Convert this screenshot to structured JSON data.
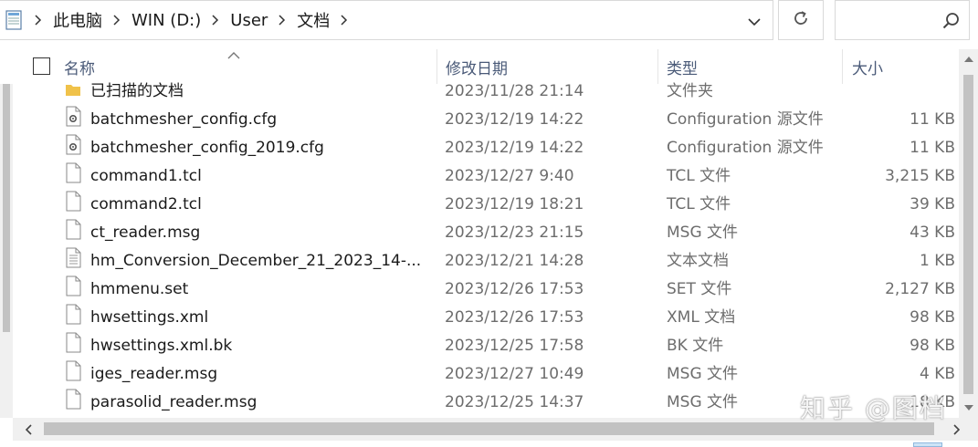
{
  "address_bar": {
    "crumbs": [
      "此电脑",
      "WIN (D:)",
      "User",
      "文档"
    ],
    "search_placeholder": ""
  },
  "columns": {
    "name": "名称",
    "date": "修改日期",
    "type": "类型",
    "size": "大小"
  },
  "files": [
    {
      "name": "已扫描的文档",
      "date": "2023/11/28 21:14",
      "type": "文件夹",
      "size": "",
      "icon": "folder-icon"
    },
    {
      "name": "batchmesher_config.cfg",
      "date": "2023/12/19 14:22",
      "type": "Configuration 源文件",
      "size": "11 KB",
      "icon": "config-file-icon"
    },
    {
      "name": "batchmesher_config_2019.cfg",
      "date": "2023/12/19 14:22",
      "type": "Configuration 源文件",
      "size": "11 KB",
      "icon": "config-file-icon"
    },
    {
      "name": "command1.tcl",
      "date": "2023/12/27 9:40",
      "type": "TCL 文件",
      "size": "3,215 KB",
      "icon": "file-icon"
    },
    {
      "name": "command2.tcl",
      "date": "2023/12/19 18:21",
      "type": "TCL 文件",
      "size": "39 KB",
      "icon": "file-icon"
    },
    {
      "name": "ct_reader.msg",
      "date": "2023/12/23 21:15",
      "type": "MSG 文件",
      "size": "43 KB",
      "icon": "file-icon"
    },
    {
      "name": "hm_Conversion_December_21_2023_14-...",
      "date": "2023/12/21 14:28",
      "type": "文本文档",
      "size": "1 KB",
      "icon": "text-file-icon"
    },
    {
      "name": "hmmenu.set",
      "date": "2023/12/26 17:53",
      "type": "SET 文件",
      "size": "2,127 KB",
      "icon": "file-icon"
    },
    {
      "name": "hwsettings.xml",
      "date": "2023/12/26 17:53",
      "type": "XML 文档",
      "size": "98 KB",
      "icon": "file-icon"
    },
    {
      "name": "hwsettings.xml.bk",
      "date": "2023/12/25 17:58",
      "type": "BK 文件",
      "size": "98 KB",
      "icon": "file-icon"
    },
    {
      "name": "iges_reader.msg",
      "date": "2023/12/27 10:49",
      "type": "MSG 文件",
      "size": "4 KB",
      "icon": "file-icon"
    },
    {
      "name": "parasolid_reader.msg",
      "date": "2023/12/25 14:37",
      "type": "MSG 文件",
      "size": "18 KB",
      "icon": "file-icon"
    }
  ],
  "watermark": "知乎 @图档",
  "colors": {
    "header_text": "#4a5a78",
    "secondary_text": "#6d6d6d",
    "folder": "#f0c24a",
    "scroll_thumb": "#c2c2c2"
  }
}
